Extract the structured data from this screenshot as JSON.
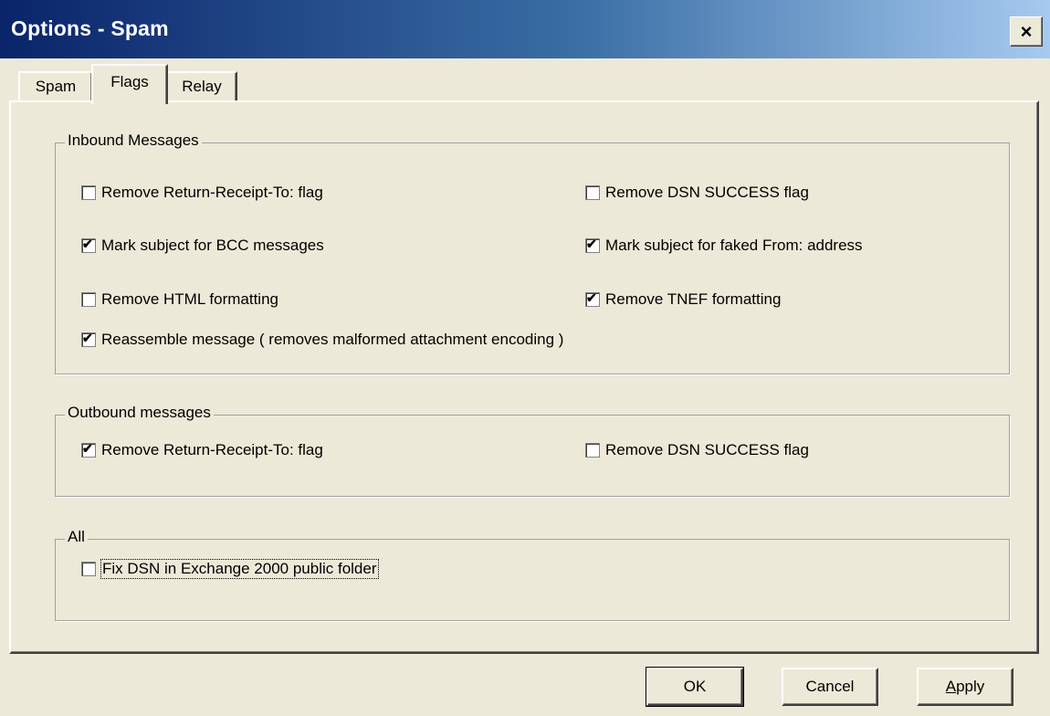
{
  "window": {
    "title": "Options - Spam",
    "close_glyph": "×"
  },
  "tabs": [
    {
      "label": "Spam",
      "active": false
    },
    {
      "label": "Flags",
      "active": true
    },
    {
      "label": "Relay",
      "active": false
    }
  ],
  "inbound": {
    "legend": "Inbound Messages",
    "items": [
      {
        "label": "Remove Return-Receipt-To: flag",
        "checked": false
      },
      {
        "label": "Remove DSN SUCCESS flag",
        "checked": false
      },
      {
        "label": "Mark subject for BCC messages",
        "checked": true
      },
      {
        "label": "Mark subject for faked From: address",
        "checked": true
      },
      {
        "label": "Remove HTML formatting",
        "checked": false
      },
      {
        "label": "Remove TNEF formatting",
        "checked": true
      },
      {
        "label": "Reassemble message ( removes malformed attachment encoding  )",
        "checked": true
      }
    ]
  },
  "outbound": {
    "legend": "Outbound messages",
    "items": [
      {
        "label": "Remove Return-Receipt-To: flag",
        "checked": true
      },
      {
        "label": "Remove DSN SUCCESS flag",
        "checked": false
      }
    ]
  },
  "all": {
    "legend": "All",
    "items": [
      {
        "label": "Fix DSN in Exchange 2000 public folder",
        "checked": false
      }
    ]
  },
  "buttons": {
    "ok": "OK",
    "cancel": "Cancel",
    "apply_first": "A",
    "apply_rest": "pply"
  },
  "icons": {
    "close": "close-icon",
    "check": "checkmark-icon"
  }
}
